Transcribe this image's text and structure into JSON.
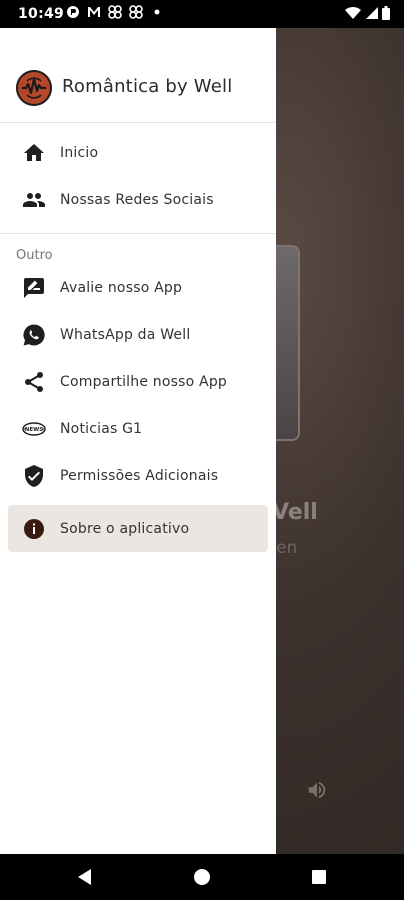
{
  "status_bar": {
    "time": "10:49",
    "icons_left": [
      "app-icon",
      "mail-icon",
      "pinwheel-icon",
      "pinwheel-icon",
      "dot-icon"
    ],
    "icons_right": [
      "wifi-icon",
      "signal-icon",
      "battery-icon"
    ]
  },
  "drawer": {
    "app_title": "Romântica by Well",
    "primary_items": [
      {
        "label": "Inicio",
        "icon": "home-icon"
      },
      {
        "label": "Nossas Redes Sociais",
        "icon": "people-icon"
      }
    ],
    "section_label": "Outro",
    "secondary_items": [
      {
        "label": "Avalie nosso App",
        "icon": "rate-review-icon"
      },
      {
        "label": "WhatsApp da Well",
        "icon": "whatsapp-icon"
      },
      {
        "label": "Compartilhe nosso App",
        "icon": "share-icon"
      },
      {
        "label": "Noticias G1",
        "icon": "news-icon"
      },
      {
        "label": "Permissões Adicionais",
        "icon": "shield-check-icon"
      }
    ],
    "selected_item": {
      "label": "Sobre o aplicativo",
      "icon": "info-icon"
    }
  },
  "background": {
    "title_fragment": "Vell",
    "subtitle_fragment": "en"
  },
  "colors": {
    "accent": "#b7472a",
    "selected_bg": "#ebe6e1",
    "info_icon": "#3a1a10"
  }
}
